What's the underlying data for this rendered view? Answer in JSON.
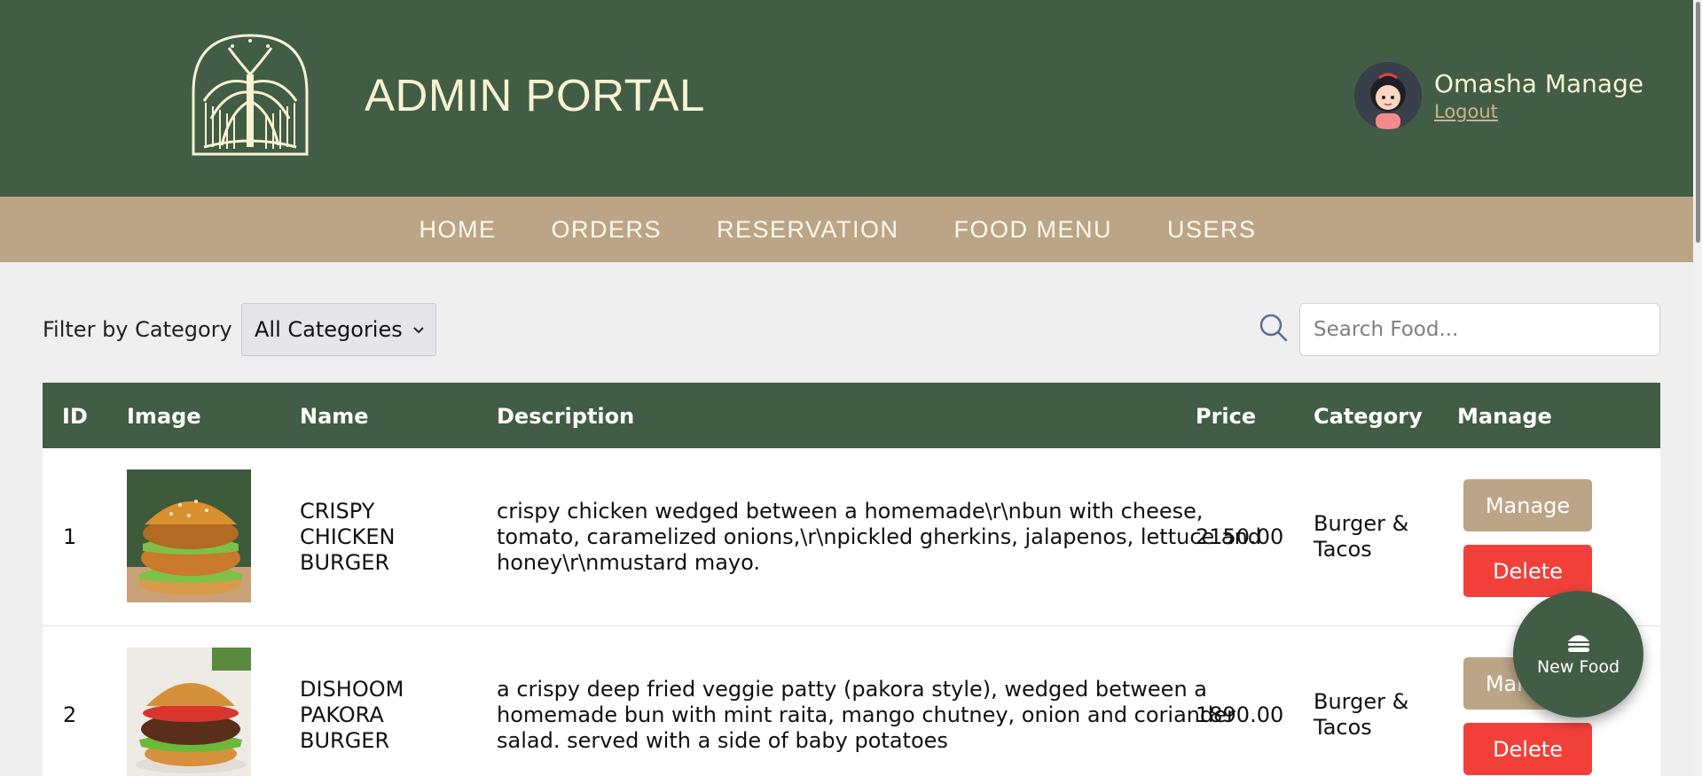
{
  "header": {
    "title": "ADMIN PORTAL",
    "user_name": "Omasha Manage",
    "logout_label": "Logout",
    "bg_color": "#425d45"
  },
  "nav": {
    "items": [
      "HOME",
      "ORDERS",
      "RESERVATION",
      "FOOD MENU",
      "USERS"
    ],
    "bg_color": "#bca586"
  },
  "toolbar": {
    "filter_label": "Filter by Category :",
    "filter_selected": "All Categories",
    "search_placeholder": "Search Food..."
  },
  "table": {
    "columns": [
      "ID",
      "Image",
      "Name",
      "Description",
      "Price",
      "Category",
      "Manage"
    ],
    "rows": [
      {
        "id": "1",
        "name_lines": [
          "CRISPY",
          "CHICKEN",
          "BURGER"
        ],
        "description_lines": [
          "crispy chicken wedged between a homemade\\r\\nbun with cheese,",
          "tomato, caramelized onions,\\r\\npickled gherkins, jalapenos, lettuce and",
          "honey\\r\\nmustard mayo."
        ],
        "price": "2150.00",
        "category_lines": [
          "Burger &",
          "Tacos"
        ],
        "manage_label": "Manage",
        "delete_label": "Delete"
      },
      {
        "id": "2",
        "name_lines": [
          "DISHOOM",
          "PAKORA",
          "BURGER"
        ],
        "description_lines": [
          "a crispy deep fried veggie patty (pakora style), wedged between a",
          "homemade bun with mint raita, mango chutney, onion and coriander",
          "salad. served with a side of baby potatoes"
        ],
        "price": "1890.00",
        "category_lines": [
          "Burger &",
          "Tacos"
        ],
        "manage_label": "Manage",
        "delete_label": "Delete"
      }
    ]
  },
  "fab": {
    "label": "New Food",
    "icon": "burger-icon"
  },
  "colors": {
    "primary_green": "#425d45",
    "tan": "#bca586",
    "delete_red": "#f1403a",
    "title_cream": "#f7f3d1"
  }
}
